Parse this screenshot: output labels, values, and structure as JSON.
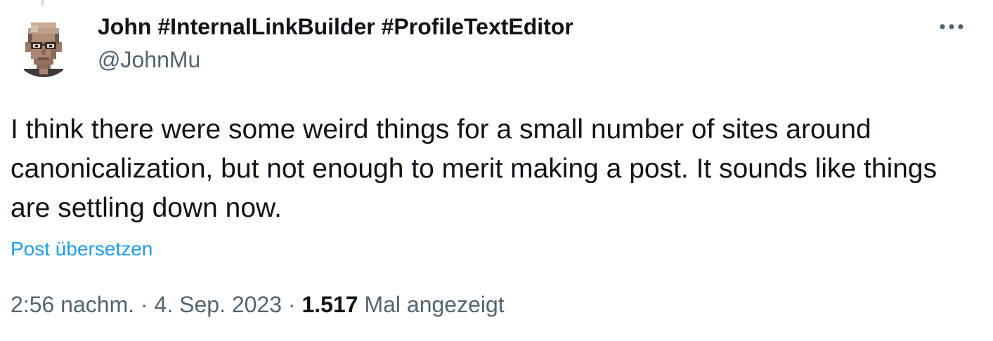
{
  "author": {
    "display_name": "John #InternalLinkBuilder #ProfileTextEditor",
    "handle": "@JohnMu",
    "avatar_icon": "pixel-portrait-avatar"
  },
  "more_icon": "more-horizontal-icon",
  "tweet": {
    "text": "I think there were some weird things for a small number of sites around canonicalization, but not enough to merit making a post. It sounds like things are settling down now.",
    "translate_label": "Post übersetzen"
  },
  "meta": {
    "time": "2:56 nachm.",
    "separator": "·",
    "date": "4. Sep. 2023",
    "views_count": "1.517",
    "views_label": "Mal angezeigt"
  },
  "colors": {
    "text_primary": "#0f1419",
    "text_secondary": "#536471",
    "link": "#1d9bf0",
    "thread_line": "#cfd9de"
  }
}
